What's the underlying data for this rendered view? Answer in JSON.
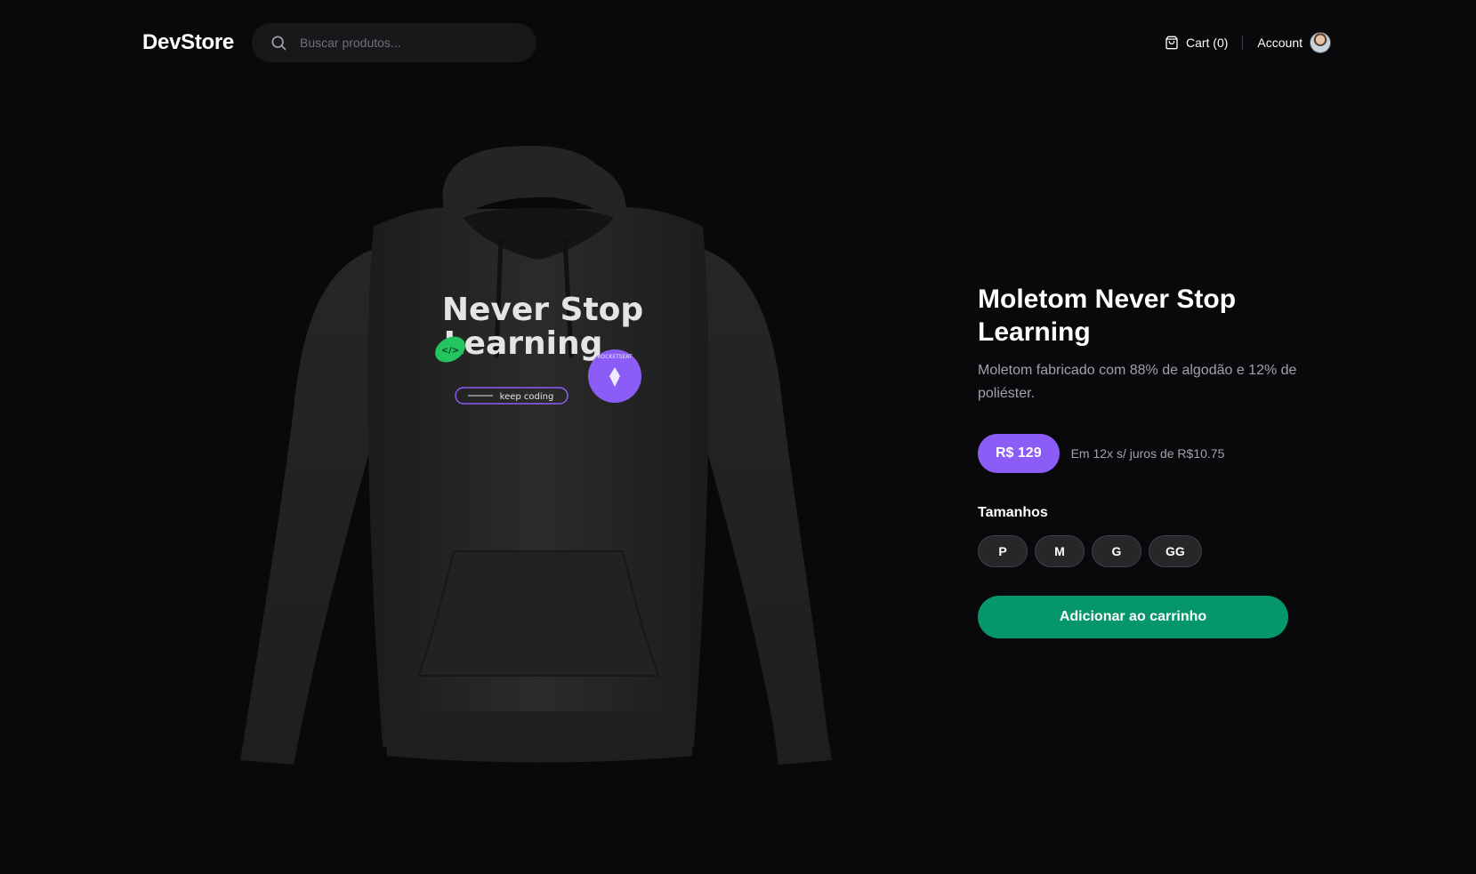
{
  "header": {
    "logo": "DevStore",
    "search_placeholder": "Buscar produtos...",
    "cart_label": "Cart (0)",
    "account_label": "Account"
  },
  "product": {
    "image_print": {
      "line1": "Never Stop",
      "line2": "Learning",
      "tagline": "keep coding",
      "tag": "</>",
      "badge_text": "ROCKETSEAT"
    },
    "title": "Moletom Never Stop Learning",
    "description": "Moletom fabricado com 88% de algodão e 12% de poliéster.",
    "price": "R$ 129",
    "installments": "Em 12x s/ juros de R$10.75",
    "sizes_label": "Tamanhos",
    "sizes": [
      "P",
      "M",
      "G",
      "GG"
    ],
    "add_to_cart_label": "Adicionar ao carrinho"
  },
  "colors": {
    "background": "#09090b",
    "price_badge": "#8b5cf6",
    "add_to_cart": "#059669"
  },
  "icons": {
    "search": "search-icon",
    "cart": "shopping-bag-icon"
  }
}
